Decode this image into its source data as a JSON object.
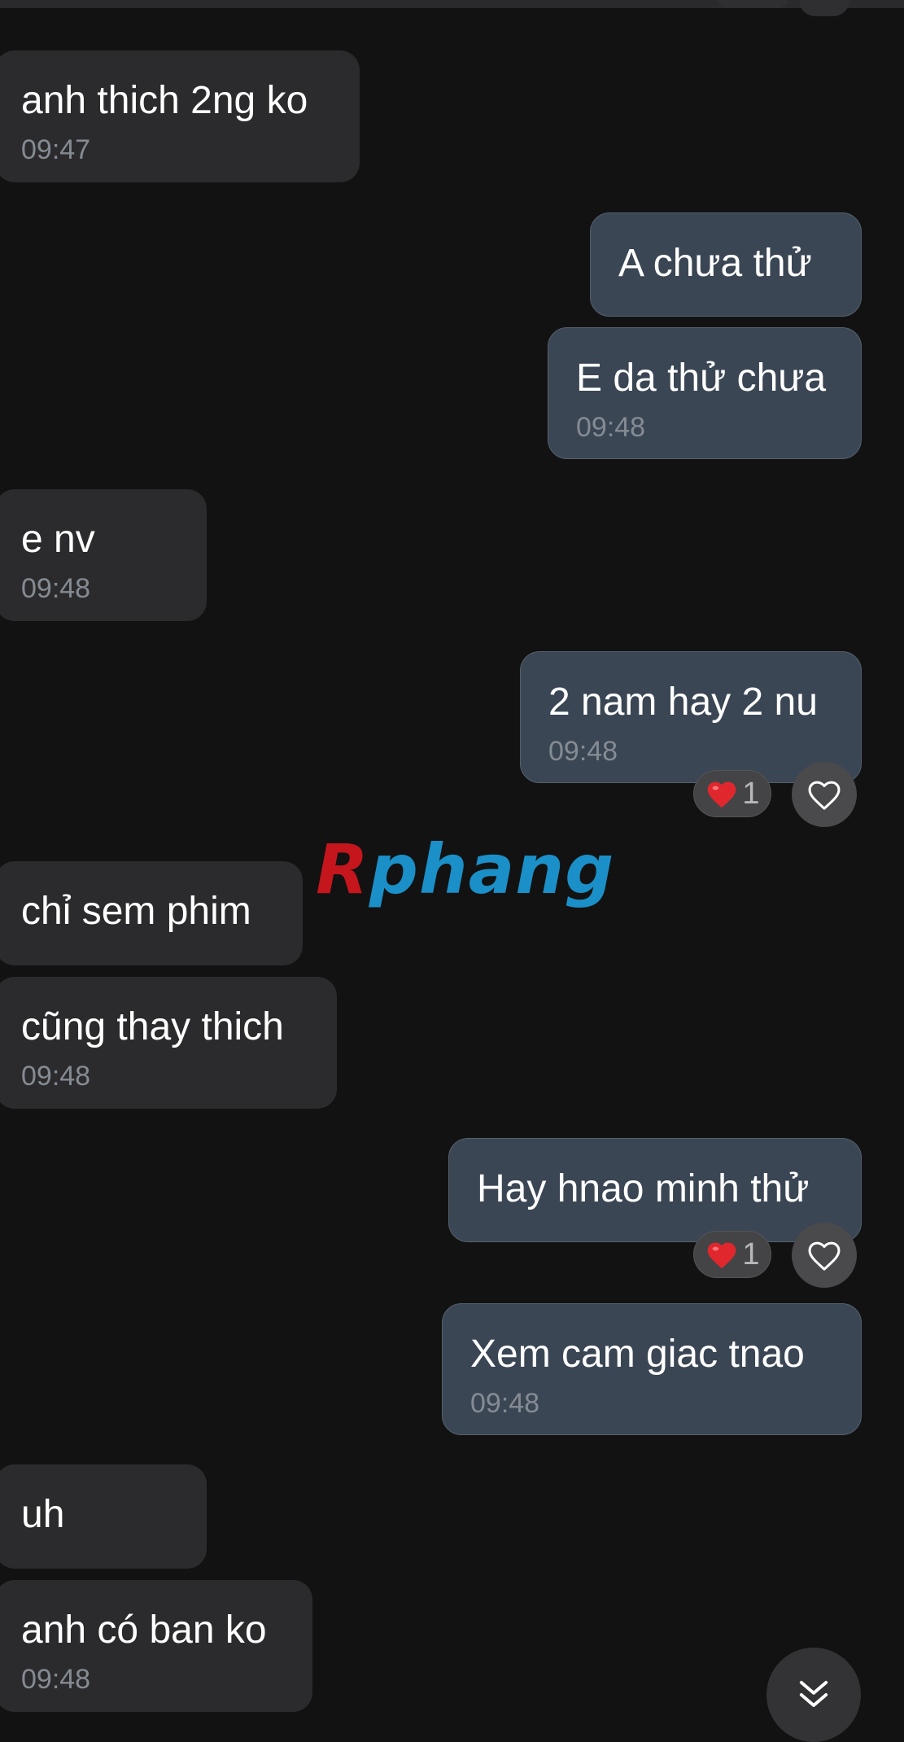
{
  "messages": [
    {
      "direction": "incoming",
      "text": "anh thich 2ng ko",
      "time": "09:47"
    },
    {
      "direction": "outgoing",
      "text": "A chưa thử"
    },
    {
      "direction": "outgoing",
      "text": "E da thử chưa",
      "time": "09:48"
    },
    {
      "direction": "incoming",
      "text": "e nv",
      "time": "09:48"
    },
    {
      "direction": "outgoing",
      "text": "2 nam hay 2 nu",
      "time": "09:48",
      "reaction": {
        "emoji": "heart",
        "count": "1"
      }
    },
    {
      "direction": "incoming",
      "text": "chỉ sem phim"
    },
    {
      "direction": "incoming",
      "text": "cũng thay thich",
      "time": "09:48"
    },
    {
      "direction": "outgoing",
      "text": "Hay hnao minh thử",
      "reaction": {
        "emoji": "heart",
        "count": "1"
      }
    },
    {
      "direction": "outgoing",
      "text": "Xem cam giac tnao",
      "time": "09:48"
    },
    {
      "direction": "incoming",
      "text": "uh"
    },
    {
      "direction": "incoming",
      "text": "anh có ban ko",
      "time": "09:48"
    }
  ],
  "watermark": {
    "first_letter": "R",
    "rest": "phang"
  },
  "colors": {
    "background": "#121212",
    "incoming_bubble": "#2b2b2d",
    "outgoing_bubble": "#3b4654",
    "heart": "#e0272d"
  },
  "icons": {
    "reaction": "heart-emoji",
    "like": "heart-outline-icon",
    "scroll": "double-chevron-down-icon"
  }
}
